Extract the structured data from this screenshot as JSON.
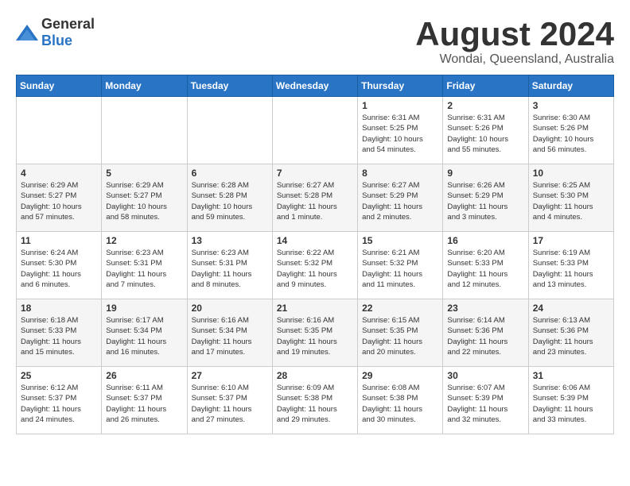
{
  "logo": {
    "general": "General",
    "blue": "Blue"
  },
  "title": "August 2024",
  "subtitle": "Wondai, Queensland, Australia",
  "days_of_week": [
    "Sunday",
    "Monday",
    "Tuesday",
    "Wednesday",
    "Thursday",
    "Friday",
    "Saturday"
  ],
  "weeks": [
    [
      {
        "day": "",
        "info": ""
      },
      {
        "day": "",
        "info": ""
      },
      {
        "day": "",
        "info": ""
      },
      {
        "day": "",
        "info": ""
      },
      {
        "day": "1",
        "info": "Sunrise: 6:31 AM\nSunset: 5:25 PM\nDaylight: 10 hours\nand 54 minutes."
      },
      {
        "day": "2",
        "info": "Sunrise: 6:31 AM\nSunset: 5:26 PM\nDaylight: 10 hours\nand 55 minutes."
      },
      {
        "day": "3",
        "info": "Sunrise: 6:30 AM\nSunset: 5:26 PM\nDaylight: 10 hours\nand 56 minutes."
      }
    ],
    [
      {
        "day": "4",
        "info": "Sunrise: 6:29 AM\nSunset: 5:27 PM\nDaylight: 10 hours\nand 57 minutes."
      },
      {
        "day": "5",
        "info": "Sunrise: 6:29 AM\nSunset: 5:27 PM\nDaylight: 10 hours\nand 58 minutes."
      },
      {
        "day": "6",
        "info": "Sunrise: 6:28 AM\nSunset: 5:28 PM\nDaylight: 10 hours\nand 59 minutes."
      },
      {
        "day": "7",
        "info": "Sunrise: 6:27 AM\nSunset: 5:28 PM\nDaylight: 11 hours\nand 1 minute."
      },
      {
        "day": "8",
        "info": "Sunrise: 6:27 AM\nSunset: 5:29 PM\nDaylight: 11 hours\nand 2 minutes."
      },
      {
        "day": "9",
        "info": "Sunrise: 6:26 AM\nSunset: 5:29 PM\nDaylight: 11 hours\nand 3 minutes."
      },
      {
        "day": "10",
        "info": "Sunrise: 6:25 AM\nSunset: 5:30 PM\nDaylight: 11 hours\nand 4 minutes."
      }
    ],
    [
      {
        "day": "11",
        "info": "Sunrise: 6:24 AM\nSunset: 5:30 PM\nDaylight: 11 hours\nand 6 minutes."
      },
      {
        "day": "12",
        "info": "Sunrise: 6:23 AM\nSunset: 5:31 PM\nDaylight: 11 hours\nand 7 minutes."
      },
      {
        "day": "13",
        "info": "Sunrise: 6:23 AM\nSunset: 5:31 PM\nDaylight: 11 hours\nand 8 minutes."
      },
      {
        "day": "14",
        "info": "Sunrise: 6:22 AM\nSunset: 5:32 PM\nDaylight: 11 hours\nand 9 minutes."
      },
      {
        "day": "15",
        "info": "Sunrise: 6:21 AM\nSunset: 5:32 PM\nDaylight: 11 hours\nand 11 minutes."
      },
      {
        "day": "16",
        "info": "Sunrise: 6:20 AM\nSunset: 5:33 PM\nDaylight: 11 hours\nand 12 minutes."
      },
      {
        "day": "17",
        "info": "Sunrise: 6:19 AM\nSunset: 5:33 PM\nDaylight: 11 hours\nand 13 minutes."
      }
    ],
    [
      {
        "day": "18",
        "info": "Sunrise: 6:18 AM\nSunset: 5:33 PM\nDaylight: 11 hours\nand 15 minutes."
      },
      {
        "day": "19",
        "info": "Sunrise: 6:17 AM\nSunset: 5:34 PM\nDaylight: 11 hours\nand 16 minutes."
      },
      {
        "day": "20",
        "info": "Sunrise: 6:16 AM\nSunset: 5:34 PM\nDaylight: 11 hours\nand 17 minutes."
      },
      {
        "day": "21",
        "info": "Sunrise: 6:16 AM\nSunset: 5:35 PM\nDaylight: 11 hours\nand 19 minutes."
      },
      {
        "day": "22",
        "info": "Sunrise: 6:15 AM\nSunset: 5:35 PM\nDaylight: 11 hours\nand 20 minutes."
      },
      {
        "day": "23",
        "info": "Sunrise: 6:14 AM\nSunset: 5:36 PM\nDaylight: 11 hours\nand 22 minutes."
      },
      {
        "day": "24",
        "info": "Sunrise: 6:13 AM\nSunset: 5:36 PM\nDaylight: 11 hours\nand 23 minutes."
      }
    ],
    [
      {
        "day": "25",
        "info": "Sunrise: 6:12 AM\nSunset: 5:37 PM\nDaylight: 11 hours\nand 24 minutes."
      },
      {
        "day": "26",
        "info": "Sunrise: 6:11 AM\nSunset: 5:37 PM\nDaylight: 11 hours\nand 26 minutes."
      },
      {
        "day": "27",
        "info": "Sunrise: 6:10 AM\nSunset: 5:37 PM\nDaylight: 11 hours\nand 27 minutes."
      },
      {
        "day": "28",
        "info": "Sunrise: 6:09 AM\nSunset: 5:38 PM\nDaylight: 11 hours\nand 29 minutes."
      },
      {
        "day": "29",
        "info": "Sunrise: 6:08 AM\nSunset: 5:38 PM\nDaylight: 11 hours\nand 30 minutes."
      },
      {
        "day": "30",
        "info": "Sunrise: 6:07 AM\nSunset: 5:39 PM\nDaylight: 11 hours\nand 32 minutes."
      },
      {
        "day": "31",
        "info": "Sunrise: 6:06 AM\nSunset: 5:39 PM\nDaylight: 11 hours\nand 33 minutes."
      }
    ]
  ]
}
